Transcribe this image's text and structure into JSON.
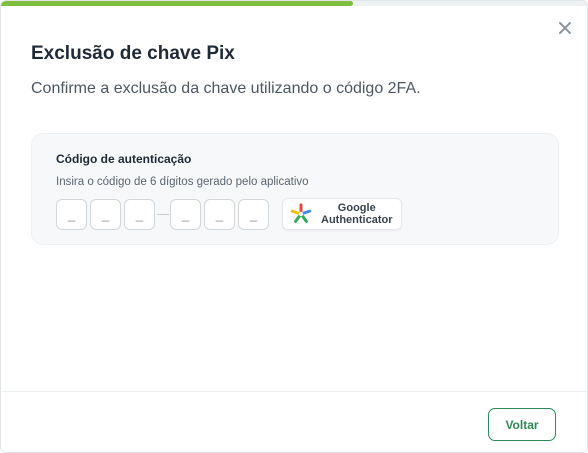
{
  "modal": {
    "progress_fraction": 0.6,
    "progress_color": "#7fbf3f",
    "close_icon": "close-icon",
    "title": "Exclusão de chave Pix",
    "subtitle": "Confirme a exclusão da chave utilizando o código 2FA."
  },
  "auth": {
    "title": "Código de autenticação",
    "hint": "Insira o código de 6 dígitos gerado pelo aplicativo",
    "code_placeholder": "_",
    "authenticator_line1": "Google",
    "authenticator_line2": "Authenticator",
    "authenticator_icon": "google-authenticator-icon"
  },
  "footer": {
    "back_label": "Voltar",
    "accent_color": "#2e8b57"
  }
}
